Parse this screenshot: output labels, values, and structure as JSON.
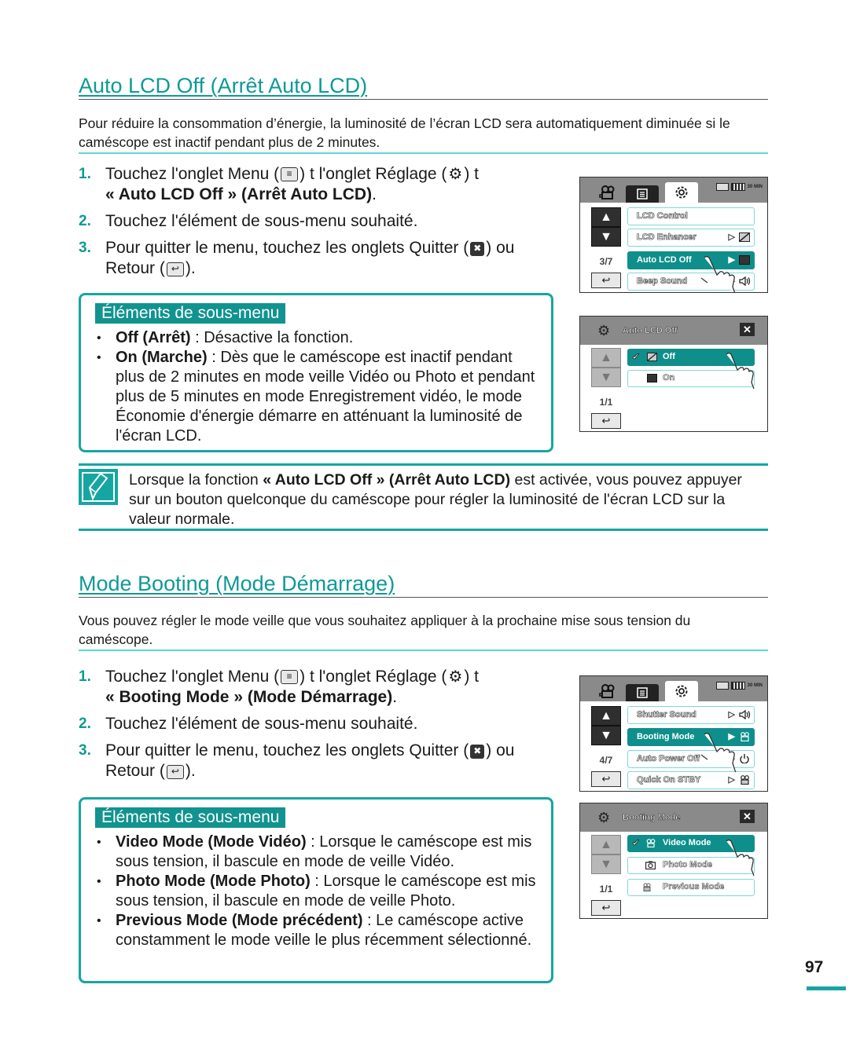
{
  "colors": {
    "accent": "#0e9a96",
    "accent_box": "#16a6a2",
    "selected_item": "#0f8f8b",
    "intro_rule": "#5fd6d6"
  },
  "section1": {
    "title": "Auto LCD Off (Arrêt Auto LCD)",
    "intro": "Pour réduire la consommation d’énergie, la luminosité de l’écran LCD sera automatiquement diminuée si le caméscope est inactif pendant plus de 2 minutes.",
    "steps": [
      {
        "num": "1.",
        "part1": "Touchez l'onglet Menu (",
        "part2": ")  t  l'onglet Réglage (",
        "part3": ")  t",
        "bold": "« Auto LCD Off » (Arrêt Auto LCD)",
        "end": "."
      },
      {
        "num": "2.",
        "text": "Touchez l'élément de sous-menu souhaité."
      },
      {
        "num": "3.",
        "part1": "Pour quitter le menu, touchez les onglets Quitter (",
        "part2": ") ou",
        "part3": "Retour (",
        "end": ")."
      }
    ],
    "submenu": {
      "heading": "Éléments de sous-menu",
      "items": [
        {
          "term": "Off (Arrêt)",
          "desc": "  : Désactive la fonction."
        },
        {
          "term": "On (Marche)",
          "desc": " : Dès que le caméscope est inactif pendant plus de 2 minutes en mode veille Vidéo ou Photo et pendant plus de 5 minutes en mode Enregistrement vidéo, le mode Économie d'énergie démarre en atténuant la luminosité de l'écran LCD."
        }
      ]
    },
    "screen_menu": {
      "page_indicator": "3/7",
      "items": [
        {
          "label": "LCD Control",
          "icon": "none",
          "selected": false
        },
        {
          "label": "LCD Enhancer",
          "icon": "lcd-enhancer-icon",
          "selected": false
        },
        {
          "label": "Auto LCD Off",
          "icon": "lcd-screen-icon",
          "selected": true
        },
        {
          "label": "Beep Sound",
          "icon": "speaker-icon",
          "selected": false
        }
      ]
    },
    "screen_popup": {
      "title": "Auto LCD Off",
      "page_indicator": "1/1",
      "options": [
        {
          "label": "Off",
          "icon": "lcd-off-icon",
          "checked": true
        },
        {
          "label": "On",
          "icon": "lcd-on-icon",
          "checked": false
        }
      ]
    },
    "note": {
      "prefix": "Lorsque la fonction ",
      "bold": "« Auto LCD Off » (Arrêt Auto LCD)",
      "suffix": " est activée, vous pouvez appuyer sur un bouton quelconque du caméscope pour régler la luminosité de l'écran LCD sur la valeur normale."
    }
  },
  "section2": {
    "title": "Mode Booting (Mode Démarrage)",
    "intro": "Vous pouvez régler le mode veille que vous souhaitez appliquer à la prochaine mise sous tension du caméscope.",
    "steps": [
      {
        "num": "1.",
        "part1": "Touchez l'onglet Menu (",
        "part2": ")  t  l'onglet Réglage (",
        "part3": ")  t",
        "bold": "« Booting Mode » (Mode Démarrage)",
        "end": "."
      },
      {
        "num": "2.",
        "text": "Touchez l'élément de sous-menu souhaité."
      },
      {
        "num": "3.",
        "part1": "Pour quitter le menu, touchez les onglets Quitter (",
        "part2": ") ou",
        "part3": "Retour (",
        "end": ")."
      }
    ],
    "submenu": {
      "heading": "Éléments de sous-menu",
      "items": [
        {
          "term": "Video Mode (Mode Vidéo)",
          "desc": "  : Lorsque le caméscope est mis sous tension, il bascule en mode de veille Vidéo."
        },
        {
          "term": "Photo Mode (Mode Photo)",
          "desc": " : Lorsque le caméscope est mis sous tension, il bascule en mode de veille Photo."
        },
        {
          "term": "Previous Mode (Mode précédent)",
          "desc": " : Le caméscope active constamment le mode veille le plus récemment sélectionné."
        }
      ]
    },
    "screen_menu": {
      "page_indicator": "4/7",
      "items": [
        {
          "label": "Shutter Sound",
          "icon": "speaker-icon",
          "selected": false
        },
        {
          "label": "Booting Mode",
          "icon": "video-camera-icon",
          "selected": true
        },
        {
          "label": "Auto Power Off",
          "icon": "auto-power-off-icon",
          "selected": false
        },
        {
          "label": "Quick On STBY",
          "icon": "quick-on-stby-icon",
          "selected": false
        }
      ]
    },
    "screen_popup": {
      "title": "Booting Mode",
      "page_indicator": "1/1",
      "options": [
        {
          "label": "Video Mode",
          "icon": "video-camera-icon",
          "checked": true
        },
        {
          "label": "Photo Mode",
          "icon": "photo-camera-icon",
          "checked": false
        },
        {
          "label": "Previous Mode",
          "icon": "previous-mode-icon",
          "checked": false
        }
      ]
    }
  },
  "status": {
    "time_remaining": "30 MIN"
  },
  "page_number": "97"
}
